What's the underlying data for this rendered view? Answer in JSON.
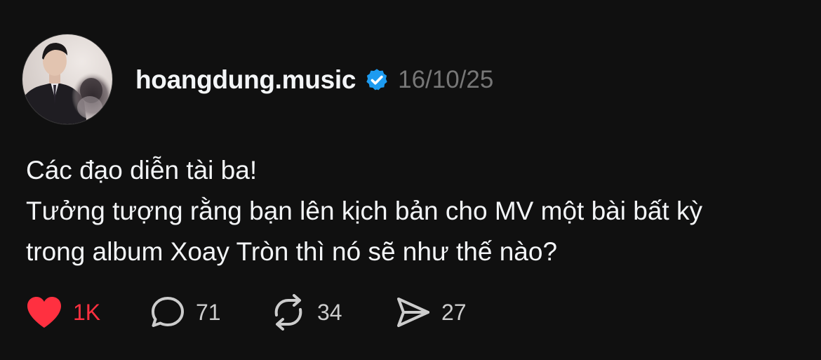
{
  "post": {
    "author": {
      "username": "hoangdung.music",
      "verified": true,
      "verified_icon": "verified-badge-icon",
      "verified_color": "#1d9bf0"
    },
    "timestamp": "16/10/25",
    "content": {
      "lines": [
        "Các đạo diễn tài ba!",
        "Tưởng tượng rằng bạn lên kịch bản cho MV một bài bất kỳ",
        "trong album Xoay Tròn thì nó sẽ như thế nào?"
      ]
    },
    "actions": {
      "like": {
        "icon": "heart-icon",
        "count": "1K",
        "active": true,
        "color": "#ff3040"
      },
      "comment": {
        "icon": "comment-bubble-icon",
        "count": "71"
      },
      "repost": {
        "icon": "repost-icon",
        "count": "34"
      },
      "share": {
        "icon": "send-icon",
        "count": "27"
      }
    }
  },
  "theme": {
    "background": "#101010",
    "text": "#f3f5f7",
    "muted": "#777777"
  }
}
